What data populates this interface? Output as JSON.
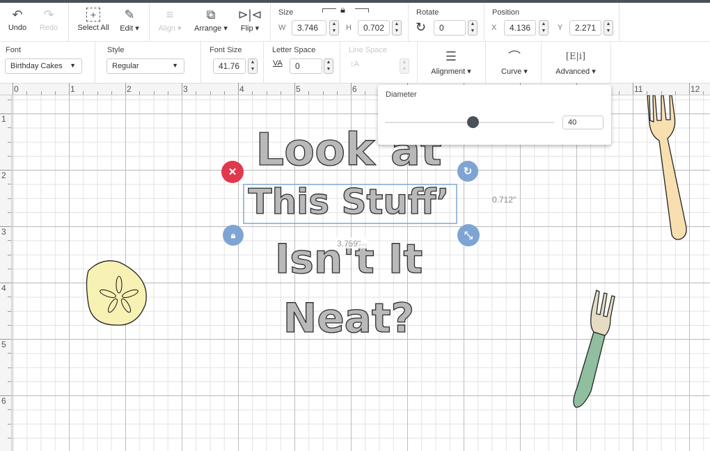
{
  "toolbar": {
    "undo": "Undo",
    "redo": "Redo",
    "select_all": "Select All",
    "edit": "Edit",
    "align": "Align",
    "arrange": "Arrange",
    "flip": "Flip",
    "size": {
      "label": "Size",
      "w_label": "W",
      "w": "3.746",
      "h_label": "H",
      "h": "0.702"
    },
    "rotate": {
      "label": "Rotate",
      "value": "0"
    },
    "position": {
      "label": "Position",
      "x_label": "X",
      "x": "4.136",
      "y_label": "Y",
      "y": "2.271"
    }
  },
  "text_toolbar": {
    "font_label": "Font",
    "font": "Birthday Cakes",
    "style_label": "Style",
    "style": "Regular",
    "font_size_label": "Font Size",
    "font_size": "41.76",
    "letter_space_label": "Letter Space",
    "letter_space": "0",
    "va": "VA",
    "line_space_label": "Line Space",
    "alignment": "Alignment",
    "curve": "Curve",
    "advanced": "Advanced"
  },
  "ruler": {
    "top": [
      "0",
      "1",
      "2",
      "3",
      "4",
      "5",
      "6",
      "11",
      "12"
    ],
    "left": [
      "1",
      "2",
      "3",
      "4",
      "5",
      "6"
    ]
  },
  "curve_popup": {
    "label": "Diameter",
    "value": "40",
    "slider_fraction": 0.52
  },
  "canvas": {
    "text_lines": [
      "Look at",
      "This Stuff’",
      "Isn't It",
      "Neat?"
    ],
    "height_label": "0.712\"",
    "width_label": "3.759\"",
    "colors": {
      "selection": "#7fa7d6",
      "delete": "#e0384c",
      "handle": "#7ea4d4",
      "text_fill": "#b9b9b9",
      "fork1": "#f8dfb0",
      "fork2": "#8fbf9f",
      "sand_dollar": "#f7f2b3"
    }
  }
}
